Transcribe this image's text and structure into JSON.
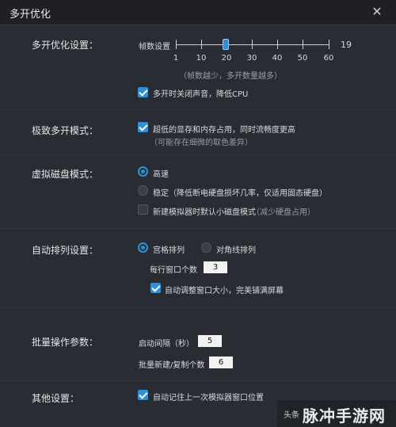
{
  "window": {
    "title": "多开优化"
  },
  "multi_open": {
    "label": "多开优化设置：",
    "fps_label": "帧数设置",
    "fps_value": "19",
    "ticks": [
      "1",
      "10",
      "20",
      "30",
      "40",
      "50",
      "60"
    ],
    "hint": "（帧数越少，多开数量越多）",
    "mute_label": "多开时关闭声音，降低CPU"
  },
  "extreme": {
    "label": "极致多开模式：",
    "option_label": "超低的显存和内存占用，同时流畅度更高",
    "option_note": "（可能存在细微的取色差异）"
  },
  "vdisk": {
    "label": "虚拟磁盘模式：",
    "fast_label": "高速",
    "stable_label": "稳定（降低断电硬盘损坏几率，仅适用固态硬盘）",
    "new_small_label": "新建模拟器时默认小磁盘模式",
    "new_small_note": "（减少硬盘占用）"
  },
  "arrange": {
    "label": "自动排列设置：",
    "grid_label": "宫格排列",
    "diagonal_label": "对角线排列",
    "per_row_label": "每行窗口个数",
    "per_row_value": "3",
    "auto_resize_label": "自动调整窗口大小，完美铺满屏幕"
  },
  "batch": {
    "label": "批量操作参数：",
    "interval_label": "启动间隔（秒）",
    "interval_value": "5",
    "count_label": "批量新建/复制个数",
    "count_value": "6"
  },
  "other": {
    "label": "其他设置：",
    "remember_label": "自动记住上一次模拟器窗口位置"
  },
  "watermark": {
    "small": "头条",
    "big": "脉冲手游网"
  }
}
